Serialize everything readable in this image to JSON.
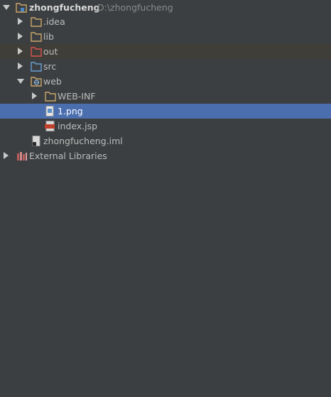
{
  "tree": {
    "root": {
      "name": "zhongfucheng",
      "path": "D:\\zhongfucheng"
    },
    "items": [
      {
        "label": ".idea"
      },
      {
        "label": "lib"
      },
      {
        "label": "out"
      },
      {
        "label": "src"
      },
      {
        "label": "web"
      },
      {
        "label": "WEB-INF"
      },
      {
        "label": "1.png"
      },
      {
        "label": "index.jsp"
      },
      {
        "label": "zhongfucheng.iml"
      },
      {
        "label": "External Libraries"
      }
    ],
    "selected_item": "1.png",
    "expanded": [
      "zhongfucheng",
      "web"
    ]
  },
  "colors": {
    "background": "#3c3f41",
    "selection": "#4b6eaf",
    "folder_default": "#c9a66b",
    "folder_excluded": "#d9534f",
    "folder_source": "#6a9fd4"
  }
}
